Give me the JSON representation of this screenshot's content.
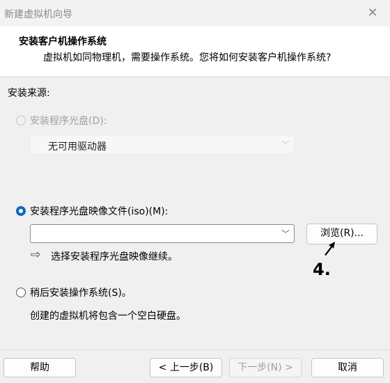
{
  "window": {
    "title": "新建虚拟机向导",
    "close_glyph": "✕"
  },
  "header": {
    "title": "安装客户机操作系统",
    "subtitle": "虚拟机如同物理机，需要操作系统。您将如何安装客户机操作系统?"
  },
  "install_source": {
    "label": "安装来源:",
    "options": [
      {
        "label": "安装程序光盘(D):",
        "selected": false,
        "enabled": false
      },
      {
        "label": "安装程序光盘映像文件(iso)(M):",
        "selected": true,
        "enabled": true
      },
      {
        "label": "稍后安装操作系统(S)。",
        "selected": false,
        "enabled": true
      }
    ],
    "disc_dropdown_value": "无可用驱动器",
    "iso_dropdown_value": "",
    "browse_label": "浏览(R)...",
    "iso_hint": "选择安装程序光盘映像继续。",
    "later_description": "创建的虚拟机将包含一个空白硬盘。"
  },
  "footer": {
    "help_label": "帮助",
    "back_label": "< 上一步(B)",
    "next_label": "下一步(N) >",
    "cancel_label": "取消"
  },
  "annotation": {
    "step_label": "4."
  },
  "colors": {
    "accent": "#0f67c1",
    "disabled_text": "#a0a0a0"
  }
}
